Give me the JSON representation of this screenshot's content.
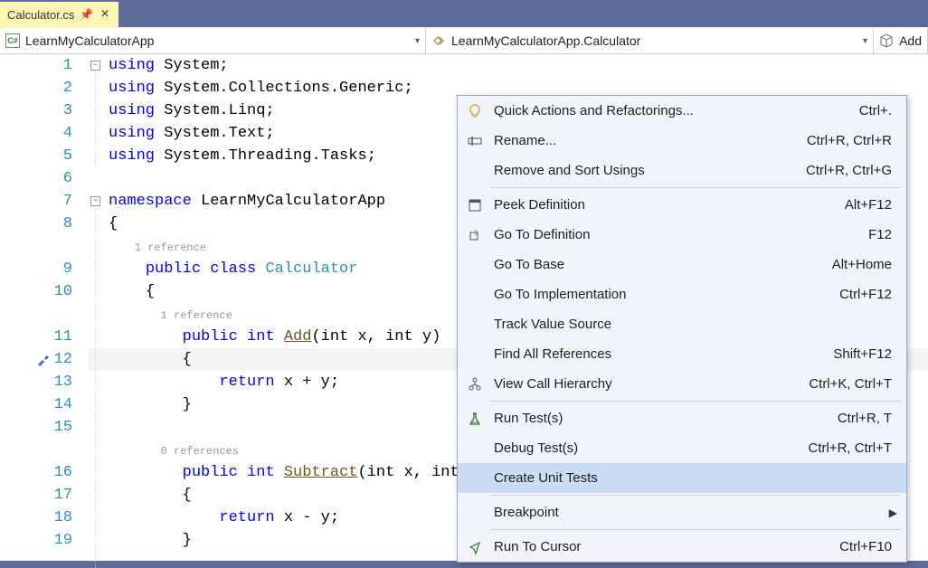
{
  "tab": {
    "title": "Calculator.cs"
  },
  "dropdowns": {
    "project": "LearnMyCalculatorApp",
    "class": "LearnMyCalculatorApp.Calculator",
    "member": "Add"
  },
  "gutter_lines": [
    "1",
    "2",
    "3",
    "4",
    "5",
    "6",
    "7",
    "8",
    "",
    "9",
    "10",
    "",
    "11",
    "12",
    "13",
    "14",
    "15",
    "",
    "16",
    "17",
    "18",
    "19"
  ],
  "code": {
    "using1_kw": "using",
    "using1_ns": " System;",
    "using2_kw": "using",
    "using2_ns": " System.Collections.Generic;",
    "using3_kw": "using",
    "using3_ns": " System.Linq;",
    "using4_kw": "using",
    "using4_ns": " System.Text;",
    "using5_kw": "using",
    "using5_ns": " System.Threading.Tasks;",
    "ns_kw": "namespace",
    "ns_name": " LearnMyCalculatorApp",
    "brace_open": "{",
    "brace_close": "}",
    "ref1": "1 reference",
    "class_mods": "public class ",
    "class_name": "Calculator",
    "ref2": "1 reference",
    "add_mods": "public ",
    "add_ret": "int ",
    "add_name": "Add",
    "add_params": "(int x, int y)",
    "add_body": "return x + y;",
    "ref0": "0 references",
    "sub_mods": "public ",
    "sub_ret": "int ",
    "sub_name": "Subtract",
    "sub_params": "(int x, int y)",
    "sub_body": "return x - y;"
  },
  "menu": [
    {
      "icon": "lightbulb",
      "label": "Quick Actions and Refactorings...",
      "shortcut": "Ctrl+."
    },
    {
      "icon": "rename",
      "label": "Rename...",
      "shortcut": "Ctrl+R, Ctrl+R"
    },
    {
      "icon": "",
      "label": "Remove and Sort Usings",
      "shortcut": "Ctrl+R, Ctrl+G"
    },
    {
      "sep": true
    },
    {
      "icon": "peek",
      "label": "Peek Definition",
      "shortcut": "Alt+F12"
    },
    {
      "icon": "goto",
      "label": "Go To Definition",
      "shortcut": "F12"
    },
    {
      "icon": "",
      "label": "Go To Base",
      "shortcut": "Alt+Home"
    },
    {
      "icon": "",
      "label": "Go To Implementation",
      "shortcut": "Ctrl+F12"
    },
    {
      "icon": "",
      "label": "Track Value Source",
      "shortcut": ""
    },
    {
      "icon": "",
      "label": "Find All References",
      "shortcut": "Shift+F12"
    },
    {
      "icon": "hierarchy",
      "label": "View Call Hierarchy",
      "shortcut": "Ctrl+K, Ctrl+T"
    },
    {
      "sep": true
    },
    {
      "icon": "flask",
      "label": "Run Test(s)",
      "shortcut": "Ctrl+R, T"
    },
    {
      "icon": "",
      "label": "Debug Test(s)",
      "shortcut": "Ctrl+R, Ctrl+T"
    },
    {
      "icon": "",
      "label": "Create Unit Tests",
      "shortcut": "",
      "selected": true
    },
    {
      "sep": true
    },
    {
      "icon": "",
      "label": "Breakpoint",
      "shortcut": "",
      "submenu": true
    },
    {
      "sep": true
    },
    {
      "icon": "cursor",
      "label": "Run To Cursor",
      "shortcut": "Ctrl+F10"
    }
  ]
}
